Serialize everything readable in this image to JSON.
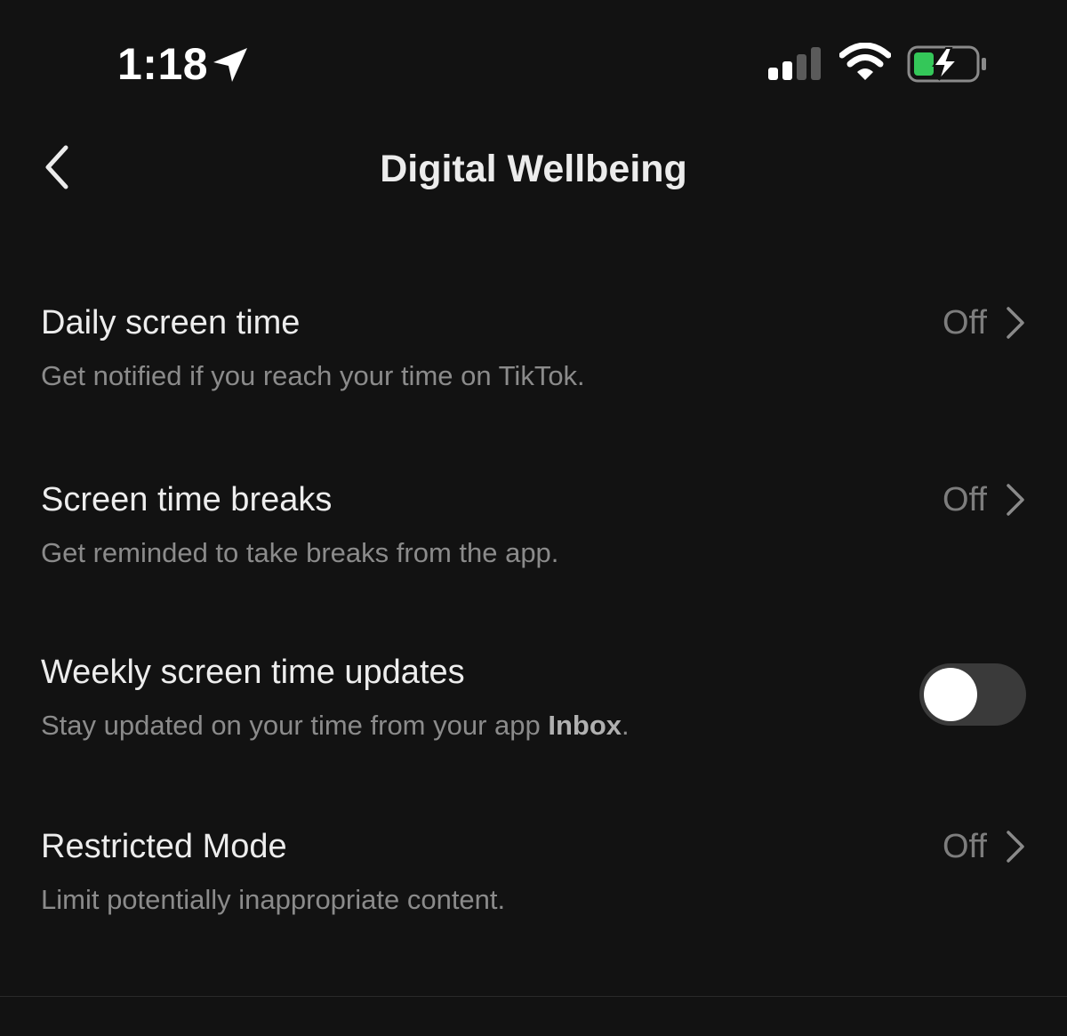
{
  "status_bar": {
    "time": "1:18",
    "location_icon": "location-arrow-icon",
    "signal_icon": "cellular-signal-icon",
    "wifi_icon": "wifi-icon",
    "battery_icon": "battery-charging-icon",
    "battery_color": "#34c759"
  },
  "header": {
    "back_icon": "chevron-left-icon",
    "title": "Digital Wellbeing"
  },
  "settings": [
    {
      "title": "Daily screen time",
      "description": "Get notified if you reach your time on TikTok.",
      "value": "Off"
    },
    {
      "title": "Screen time breaks",
      "description": "Get reminded to take breaks from the app.",
      "value": "Off"
    },
    {
      "title": "Weekly screen time updates",
      "description_prefix": "Stay updated on your time from your app ",
      "description_bold": "Inbox",
      "description_suffix": ".",
      "toggle_on": false
    },
    {
      "title": "Restricted Mode",
      "description": "Limit potentially inappropriate content.",
      "value": "Off"
    }
  ]
}
